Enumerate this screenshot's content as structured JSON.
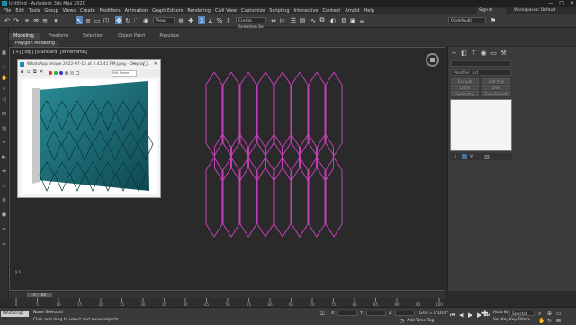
{
  "window": {
    "title": "Untitled - Autodesk 3ds Max 2020",
    "controls": [
      "—",
      "□",
      "✕"
    ]
  },
  "menu": {
    "items": [
      "File",
      "Edit",
      "Tools",
      "Group",
      "Views",
      "Create",
      "Modifiers",
      "Animation",
      "Graph Editors",
      "Rendering",
      "Civil View",
      "Customize",
      "Scripting",
      "Interactive",
      "Content",
      "Arnold",
      "Help"
    ],
    "sign_in": "Sign In",
    "workspaces_label": "Workspaces:",
    "workspace_value": "Default"
  },
  "toolbar": {
    "view_dropdown": "View",
    "selection_set_placeholder": "Create Selection Se",
    "layer_dropdown": "0 (default)"
  },
  "ribbon": {
    "tabs": [
      "Modeling",
      "Freeform",
      "Selection",
      "Object Paint",
      "Populate"
    ],
    "active_tab": "Modeling",
    "panel_label": "Polygon Modeling"
  },
  "viewport": {
    "label": "[+] [Top] [Standard] [Wireframe]",
    "axis": "y  x",
    "mesh_color": "#c53fb8"
  },
  "photo_window": {
    "title": "WhatsApp Image 2022-07-15 at 2.41.41 PM.jpeg - Display ...",
    "edit_name": "Edit Name",
    "controls": [
      "—",
      "□",
      "✕"
    ],
    "panel_color": "#1f6e78"
  },
  "command_panel": {
    "modifier_list": "Modifier List",
    "buttons": [
      "Extrude",
      "Edit Poly",
      "Lathe",
      "Shell",
      "Symmetry",
      "TurboSmooth"
    ]
  },
  "timeline": {
    "slider_label": "0 / 100",
    "ticks": [
      "0",
      "5",
      "10",
      "15",
      "20",
      "25",
      "30",
      "35",
      "40",
      "45",
      "50",
      "55",
      "60",
      "65",
      "70",
      "75",
      "80",
      "85",
      "90",
      "95",
      "100"
    ]
  },
  "status": {
    "maxscript": "MAXScript Mi",
    "selection": "None Selected",
    "prompt": "Click and drag to select and move objects",
    "x_label": "X:",
    "y_label": "Y:",
    "z_label": "Z:",
    "grid": "Grid = 0'10.0\"",
    "add_time_tag": "Add Time Tag",
    "auto_key": "Auto Key",
    "selected": "Selected",
    "set_key": "Set Key",
    "key_filters": "Key Filters..."
  }
}
